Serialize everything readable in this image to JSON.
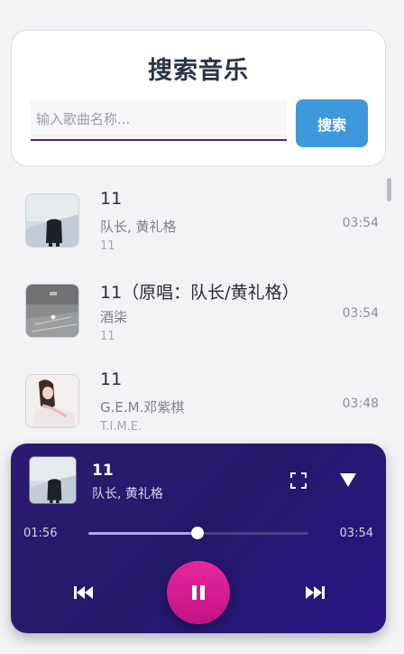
{
  "search": {
    "title": "搜索音乐",
    "placeholder": "输入歌曲名称...",
    "button_label": "搜索"
  },
  "results": [
    {
      "title": "11",
      "artist": "队长, 黄礼格",
      "album": "11",
      "duration": "03:54"
    },
    {
      "title": "11（原唱：队长/黄礼格）",
      "artist": "酒柒",
      "album": "11",
      "duration": "03:54"
    },
    {
      "title": "11",
      "artist": "G.E.M.邓紫棋",
      "album": "T.I.M.E.",
      "duration": "03:48"
    }
  ],
  "player": {
    "title": "11",
    "artist": "队长, 黄礼格",
    "current_time": "01:56",
    "total_time": "03:54",
    "progress": 0.497,
    "state": "playing"
  },
  "colors": {
    "accent": "#3f98db",
    "player_bg": "#24186b",
    "play_button": "#d51d91"
  }
}
